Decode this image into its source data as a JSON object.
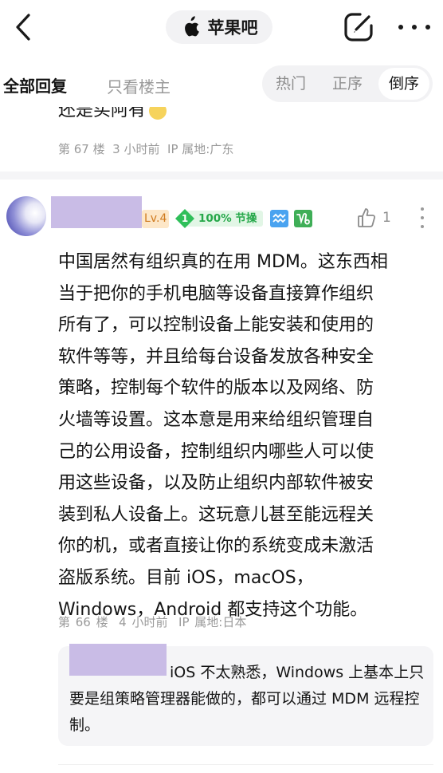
{
  "header": {
    "forum_name": "苹果吧",
    "icons": {
      "back": "chevron-left-icon",
      "forum": "apple-logo-icon",
      "compose": "compose-icon",
      "more": "more-horizontal-icon"
    }
  },
  "filter": {
    "tab_all": "全部回复",
    "tab_host_only": "只看楼主",
    "sort_options": [
      "热门",
      "正序",
      "倒序"
    ],
    "sort_selected": "倒序"
  },
  "previous_post": {
    "text_partial": "还是买阿有",
    "floor": "第 67 楼",
    "time": "3 小时前",
    "ip": "IP 属地:广东"
  },
  "post": {
    "level": "Lv.4",
    "rate_level": "1",
    "rate_text": "100% 节操",
    "like_count": "1",
    "body": "中国居然有组织真的在用 MDM。这东西相\n当于把你的手机电脑等设备直接算作组织\n所有了，可以控制设备上能安装和使用的\n软件等等，并且给每台设备发放各种安全\n策略，控制每个软件的版本以及网络、防\n火墙等设置。这本意是用来给组织管理自\n己的公用设备，控制组织内哪些人可以使\n用这些设备，以及防止组织内部软件被安\n装到私人设备上。这玩意儿甚至能远程关\n你的机，或者直接让你的系统变成未激活\n盗版系统。目前 iOS，macOS，\nWindows，Android 都支持这个功能。",
    "floor": "第 66 楼",
    "time": "4 小时前",
    "ip": "IP 属地:日本"
  },
  "sub_reply": {
    "text": "iOS 不太熟悉，Windows 上基本上只要是组策略管理器能做的，都可以通过 MDM 远程控制。"
  },
  "colors": {
    "redaction": "#c9bce6",
    "level_badge_bg": "#fde7c8",
    "level_badge_text": "#cf7a1e",
    "rate_green": "#26a84a",
    "zodiac_aquarius": "#4aa3f0",
    "zodiac_capricorn": "#3fae57"
  }
}
